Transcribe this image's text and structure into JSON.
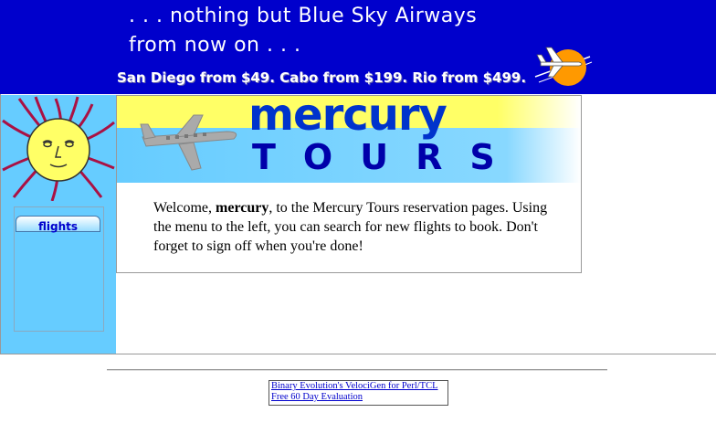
{
  "banner": {
    "line1": ". . . nothing but Blue Sky Airways",
    "line2": "from now on . . .",
    "prices": "San Diego from $49. Cabo from $199. Rio from $499.",
    "plane_icon": "airplane-sun-icon"
  },
  "logo": {
    "word1": "mercury",
    "word2": "TOURS",
    "sun_icon": "sun-face-icon",
    "plane_icon": "airplane-icon"
  },
  "nav": {
    "items": [
      {
        "label": "flights"
      }
    ]
  },
  "welcome": {
    "prefix": "Welcome, ",
    "username": "mercury",
    "suffix": ", to the Mercury Tours reservation pages. Using the menu to the left, you can search for new flights to book. Don't forget to sign off when you're done!"
  },
  "footer": {
    "ad_line1": "Binary Evolution's VelociGen for Perl/TCL",
    "ad_line2": "Free 60 Day Evaluation"
  },
  "colors": {
    "banner_blue": "#0000cc",
    "sidebar_blue": "#66ccff",
    "logo_yellow": "#ffff66",
    "link_blue": "#0000cc"
  }
}
